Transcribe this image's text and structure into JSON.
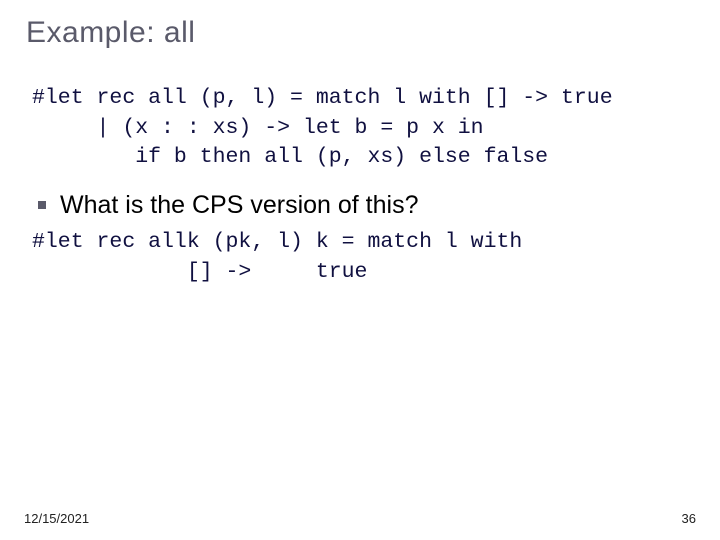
{
  "title": "Example: all",
  "code1": "#let rec all (p, l) = match l with [] -> true\n     | (x : : xs) -> let b = p x in\n        if b then all (p, xs) else false",
  "question": "What is the CPS version of this?",
  "code2": "#let rec allk (pk, l) k = match l with\n            [] ->     true",
  "footer": {
    "date": "12/15/2021",
    "page": "36"
  }
}
